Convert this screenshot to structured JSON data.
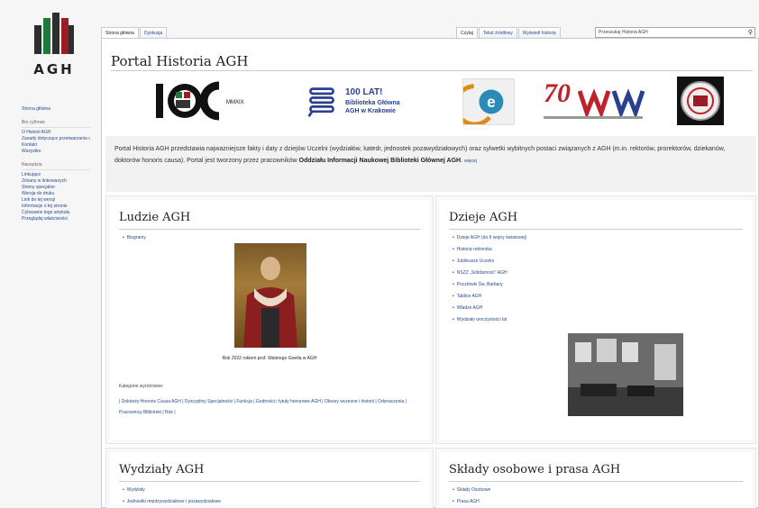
{
  "logo": {
    "text": "AGH"
  },
  "sidebar": {
    "nav": [
      "Strona główna"
    ],
    "section1_head": "Bio cyfrowe",
    "section1": [
      "O Historii AGH",
      "Zasady dotyczące przetwarzania danych",
      "Kontakt",
      "Wszystko"
    ],
    "section2_head": "Narzędzia",
    "section2": [
      "Linkujące",
      "Zmiany w linkowanych",
      "Strony specjalne",
      "Wersja do druku",
      "Link do tej wersji",
      "Informacje o tej stronie",
      "Cytowanie tego artykułu",
      "Przeglądaj właściwości"
    ]
  },
  "tabs": {
    "left": [
      "Strona główna",
      "Dyskusja"
    ],
    "right": [
      "Czytaj",
      "Tekst źródłowy",
      "Wyświetl historię"
    ]
  },
  "search": {
    "value": "Przeszukaj Historia AGH"
  },
  "page": {
    "title": "Portal Historia AGH"
  },
  "logos": {
    "l1": "100",
    "l2_title": "100 LAT!",
    "l2_line1": "Biblioteka Główna",
    "l2_line2": "AGH w Krakowie",
    "l3": "e",
    "l4": "70"
  },
  "intro": {
    "text1": "Portal Historia AGH przedstawia najważniejsze fakty i daty z dziejów Uczelni (wydziałów, katedr, jednostek pozawydziałowych) oraz sylwetki wybitnych postaci związanych z AGH (m.in. rektorów, prorektorów, dziekanów, doktorów honoris causa). Portal jest tworzony przez pracowników ",
    "bold": "Oddziału Informacji Naukowej Biblioteki Głównej AGH",
    "more": "więcej"
  },
  "ludzie": {
    "title": "Ludzie AGH",
    "items": [
      "Biogramy"
    ],
    "caption": "Rok 2022 rokiem prof. Walerego Goetla w AGH",
    "cat_label": "Kategorie wyróżnione:",
    "cat_links": "| Doktorzy Honoris Causa AGH | Dyscypliny Specjalności | Funkcja | Godności i tytuły honorowe AGH | Okresy wczesne i historii | Odznaczenia | Pracownicy Biblioteki | Rok |"
  },
  "dzieje": {
    "title": "Dzieje AGH",
    "items": [
      "Dzieje AGH (do II wojny światowej)",
      "Historia rektorska",
      "Jubileusze Uczelni",
      "NSZZ „Solidarność” AGH",
      "Pocztówki Św. Barbary",
      "Tablice AGH",
      "Władze AGH",
      "Wydziały uroczystości lat"
    ]
  },
  "wydzialy": {
    "title": "Wydziały AGH",
    "items": [
      "Wydziały",
      "Jednostki międzywydziałowe i pozawydziałowe"
    ]
  },
  "sklady": {
    "title": "Składy osobowe i prasa AGH",
    "items": [
      "Składy Osobowe",
      "Prasa AGH"
    ]
  }
}
